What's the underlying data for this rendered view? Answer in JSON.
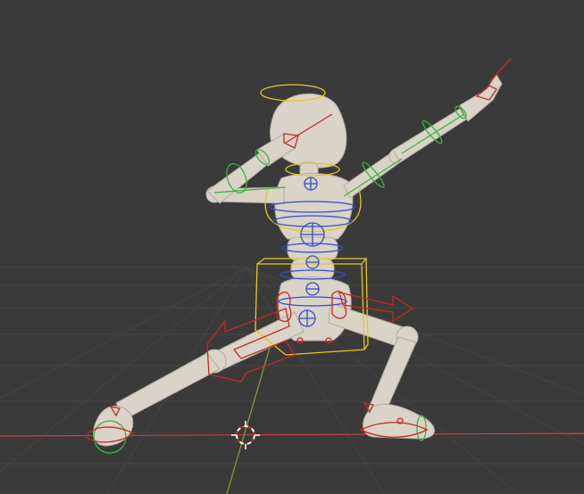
{
  "viewport": {
    "background": "#3a3a3a",
    "grid_color": "#454545",
    "x_axis_color": "#c8403c",
    "y_axis_color": "#7fa33c",
    "body_color": "#d9d3c8",
    "body_shadow": "#b4ad9f",
    "ik_control_color": "#c8281e",
    "fk_control_color": "#3cb43c",
    "spine_control_color": "#3250c8",
    "root_control_color": "#e6c81e",
    "cursor_colors": [
      "#ffffff",
      "#c8281e"
    ]
  },
  "objects": [
    {
      "name": "armature-rig",
      "kind": "armature"
    },
    {
      "name": "character-mesh",
      "kind": "mesh"
    },
    {
      "name": "3d-cursor",
      "kind": "cursor"
    }
  ]
}
